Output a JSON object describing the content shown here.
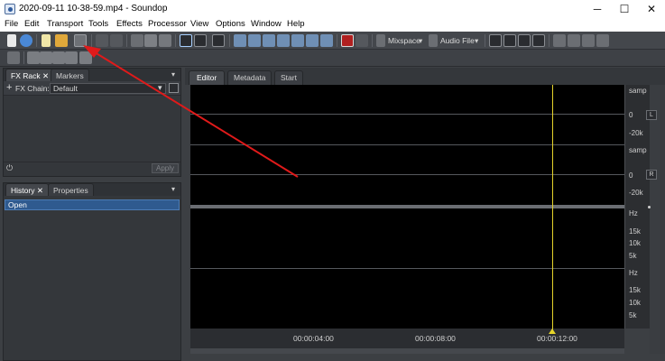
{
  "window": {
    "title": "2020-09-11 10-38-59.mp4 - Soundop",
    "minimize": "─",
    "maximize": "☐",
    "close": "✕"
  },
  "menu": [
    "File",
    "Edit",
    "Transport",
    "Tools",
    "Effects",
    "Processor",
    "View",
    "Options",
    "Window",
    "Help"
  ],
  "toolbar": {
    "mixspace_label": "Mixspace",
    "audio_file_label": "Audio File"
  },
  "fx_panel": {
    "tabs": [
      "FX Rack",
      "Markers"
    ],
    "fx_chain_label": "FX Chain:",
    "fx_chain_value": "Default",
    "apply_label": "Apply"
  },
  "history_panel": {
    "tabs": [
      "History",
      "Properties"
    ],
    "items": [
      "Open"
    ]
  },
  "editor": {
    "tabs": [
      "Editor",
      "Metadata",
      "Start"
    ],
    "ruler_labels": [
      "samp",
      "0",
      "-20k",
      "samp",
      "0",
      "-20k",
      "Hz",
      "15k",
      "10k",
      "5k",
      "Hz",
      "15k",
      "10k",
      "5k"
    ],
    "channel_buttons": [
      "L",
      "R"
    ],
    "time_labels": [
      "00:00:04:00",
      "00:00:08:00",
      "00:00:12:00"
    ]
  },
  "colors": {
    "annotation_arrow": "#e01a1a",
    "playhead": "#e6d52a"
  }
}
